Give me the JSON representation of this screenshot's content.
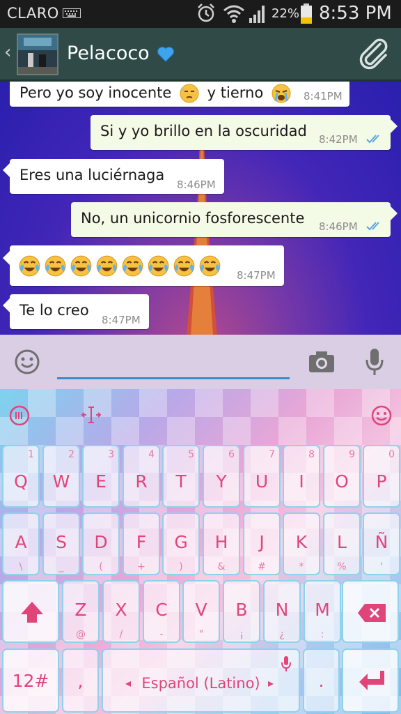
{
  "status_bar": {
    "carrier": "CLARO",
    "battery_percent": "22%",
    "time": "8:53 PM"
  },
  "header": {
    "contact_name": "Pelacoco",
    "back_glyph": "‹"
  },
  "messages": [
    {
      "direction": "in",
      "text": "Pero yo soy inocente",
      "text2": "y tierno",
      "time": "8:41PM"
    },
    {
      "direction": "out",
      "text": "Si y yo brillo en la oscuridad",
      "time": "8:42PM",
      "read": true
    },
    {
      "direction": "in",
      "text": "Eres una luciérnaga",
      "time": "8:46PM"
    },
    {
      "direction": "out",
      "text": "No, un unicornio fosforescente",
      "time": "8:46PM",
      "read": true
    },
    {
      "direction": "in",
      "emoji_count": 8,
      "emoji": "face-with-tears-of-joy",
      "time": "8:47PM"
    },
    {
      "direction": "in",
      "text": "Te lo creo",
      "time": "8:47PM"
    }
  ],
  "input": {
    "placeholder": ""
  },
  "keyboard": {
    "row1": [
      {
        "letter": "Q",
        "hint": "1"
      },
      {
        "letter": "W",
        "hint": "2"
      },
      {
        "letter": "E",
        "hint": "3"
      },
      {
        "letter": "R",
        "hint": "4"
      },
      {
        "letter": "T",
        "hint": "5"
      },
      {
        "letter": "Y",
        "hint": "6"
      },
      {
        "letter": "U",
        "hint": "7"
      },
      {
        "letter": "I",
        "hint": "8"
      },
      {
        "letter": "O",
        "hint": "9"
      },
      {
        "letter": "P",
        "hint": "0"
      }
    ],
    "row2": [
      {
        "letter": "A",
        "hint": "\\"
      },
      {
        "letter": "S",
        "hint": "_"
      },
      {
        "letter": "D",
        "hint": "("
      },
      {
        "letter": "F",
        "hint": "+"
      },
      {
        "letter": "G",
        "hint": ")"
      },
      {
        "letter": "H",
        "hint": "&"
      },
      {
        "letter": "J",
        "hint": "#"
      },
      {
        "letter": "K",
        "hint": "*"
      },
      {
        "letter": "L",
        "hint": "%"
      },
      {
        "letter": "Ñ",
        "hint": "'"
      }
    ],
    "row3": [
      {
        "letter": "Z",
        "hint": "@"
      },
      {
        "letter": "X",
        "hint": "/"
      },
      {
        "letter": "C",
        "hint": "-"
      },
      {
        "letter": "V",
        "hint": "\""
      },
      {
        "letter": "B",
        "hint": "¡"
      },
      {
        "letter": "N",
        "hint": "¿"
      },
      {
        "letter": "M",
        "hint": ":"
      }
    ],
    "symbols_label": "12#",
    "comma_label": ",",
    "space_label": "Español (Latino)",
    "period_label": "."
  },
  "colors": {
    "header_bg": "#2f4a47",
    "tick_blue": "#5aa7e0",
    "key_text": "#e0457a",
    "key_border": "#8fd2ec"
  }
}
